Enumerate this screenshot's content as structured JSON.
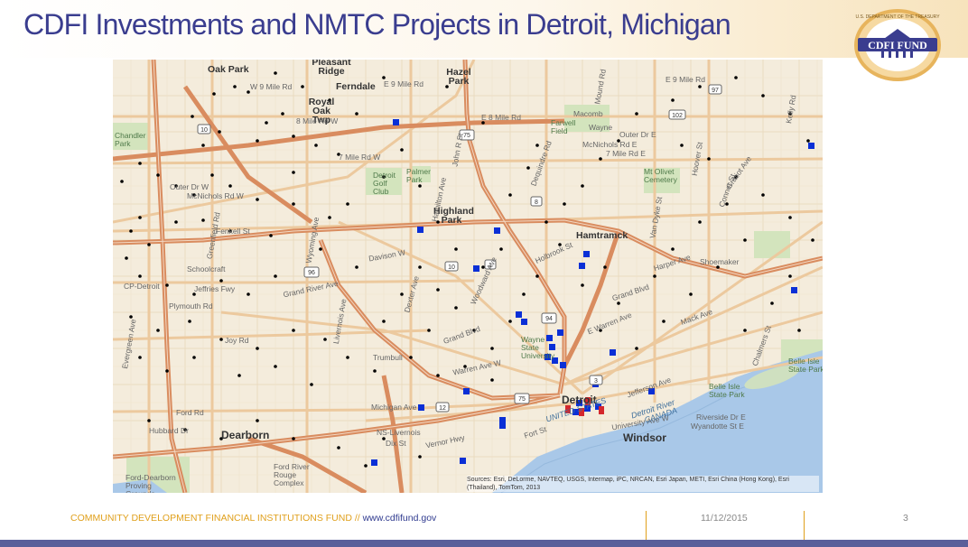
{
  "slide": {
    "title": "CDFI Investments and NMTC Projects in Detroit, Michigan",
    "logo_text": "CDFI FUND",
    "logo_ring_text": "U.S. DEPARTMENT OF THE TREASURY"
  },
  "map": {
    "labels": {
      "oak_park": "Oak Park",
      "pleasant_ridge": "Pleasant Ridge",
      "hazel_park": "Hazel Park",
      "ferndale": "Ferndale",
      "royal_oak_twp": "Royal Oak Twp",
      "w9mile": "W 9 Mile Rd",
      "e9mile": "E 9 Mile Rd",
      "e9mile2": "E 9 Mile Rd",
      "w8mile": "8 Mile Rd W",
      "e8mile": "E 8 Mile Rd",
      "macomb": "Macomb",
      "wayne": "Wayne",
      "farwell_field": "Farwell Field",
      "outer_dr_e": "Outer Dr E",
      "mcnichols_e": "McNichols Rd E",
      "e7mile": "7 Mile Rd E",
      "mt_olivet": "Mt Olivet Cemetery",
      "w7mile": "7 Mile Rd W",
      "detroit_golf": "Detroit Golf Club",
      "palmer_park": "Palmer Park",
      "outer_dr_w": "Outer Dr W",
      "mcnichols_w": "McNichols Rd W",
      "highland_park": "Highland Park",
      "hamtramck": "Hamtramck",
      "fenkell": "Fenkell St",
      "schoolcraft": "Schoolcraft",
      "cp_detroit": "CP-Detroit",
      "jeffries": "Jeffries Fwy",
      "plymouth": "Plymouth Rd",
      "grand_river": "Grand River Ave",
      "joy_rd": "Joy Rd",
      "grand_blvd": "Grand Blvd",
      "harper": "Harper Ave",
      "mack": "Mack Ave",
      "e_warren": "E Warren Ave",
      "jefferson": "Jefferson Ave",
      "michigan_ave": "Michigan Ave",
      "ford_rd": "Ford Rd",
      "dearborn": "Dearborn",
      "hubbard": "Hubbard Dr",
      "ns_livernois": "NS-Livernois",
      "dix": "Dix St",
      "ford_rouge": "Ford River Rouge Complex",
      "ford_dearborn": "Ford-Dearborn Proving Grounds",
      "detroit": "Detroit",
      "windsor": "Windsor",
      "detroit_river": "Detroit River",
      "riverside_dr": "Riverside Dr E",
      "wyandotte": "Wyandotte St E",
      "university_ave": "University Ave W",
      "belle_isle": "Belle Isle State Park",
      "belle_isle2": "Belle Isle State Park",
      "united_states": "UNITED STATES",
      "canada": "CANADA",
      "chandler_park": "Chandler Park",
      "wayne_state": "Wayne State University",
      "davison": "Davison W",
      "holbrook": "Holbrook St",
      "trumbull": "Trumbull",
      "warren_w": "Warren Ave W",
      "vernor": "Vernor Hwy",
      "fort_st": "Fort St",
      "chalmers": "Chalmers St",
      "connor": "Conner St",
      "schoemaker": "Shoemaker",
      "gratiot": "Gratiot Ave",
      "van_dyke": "Van Dyke St",
      "hoover": "Hoover St",
      "kelly": "Kelly Rd",
      "evergreen": "Evergreen Ave",
      "greenfield": "Greenfield Rd",
      "wyoming": "Wyoming Ave",
      "livernois": "Livernois Ave",
      "dexter": "Dexter Ave",
      "hamilton": "Hamilton Ave",
      "woodward": "Woodward Ave",
      "john_r": "John R St",
      "dequindre": "Dequindre Rd",
      "mound": "Mound Rd",
      "i75": "75",
      "i94": "94",
      "i96": "96",
      "route_10": "10",
      "route_1": "1",
      "route_3": "3",
      "route_8": "8",
      "route_12": "12",
      "route_97": "97",
      "route_102": "102"
    },
    "attribution": "Sources: Esri, DeLorme, NAVTEQ, USGS, Intermap, iPC, NRCAN, Esri Japan, METI, Esri China (Hong Kong), Esri (Thailand), TomTom, 2013"
  },
  "footer": {
    "org": "COMMUNITY DEVELOPMENT FINANCIAL INSTITUTIONS FUND",
    "separator": " // ",
    "url": "www.cdfifund.gov",
    "date": "11/12/2015",
    "page": "3"
  },
  "colors": {
    "title": "#3a3d8f",
    "map_land": "#f4ecdc",
    "water": "#a9c8e8",
    "park": "#d3e4bd",
    "highway": "#d98c5f",
    "arterial": "#ecc99e",
    "minor_road": "#e9d8bd",
    "cdfi_marker": "#0a2fd6",
    "nmtc_marker": "#000000",
    "footer_accent": "#e0a01c",
    "bottom_bar": "#5a5f9a"
  },
  "markers": {
    "legend_names": [
      "cdfi-investment-marker",
      "nmtc-project-marker",
      "downtown-pin-marker"
    ]
  }
}
